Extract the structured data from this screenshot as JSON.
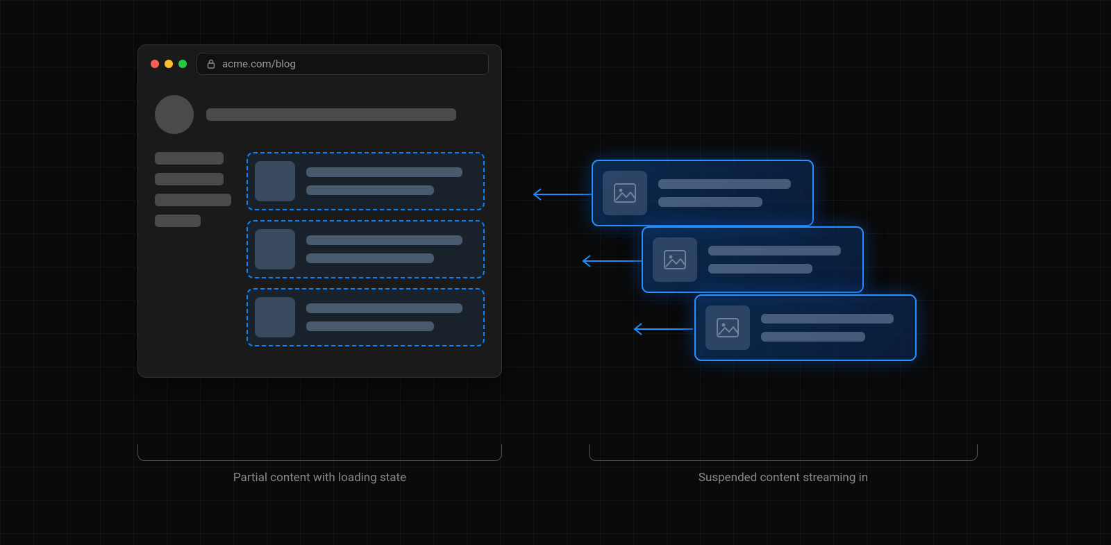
{
  "browser": {
    "url": "acme.com/blog",
    "traffic_lights": {
      "red": "#ff5f57",
      "yellow": "#febc2e",
      "green": "#28c840"
    }
  },
  "colors": {
    "accent_blue": "#0a84ff",
    "border_blue": "#2a8fff"
  },
  "captions": {
    "left": "Partial content with loading state",
    "right": "Suspended content streaming in"
  },
  "streaming_cards_count": 3,
  "dashed_placeholder_cards_count": 3
}
